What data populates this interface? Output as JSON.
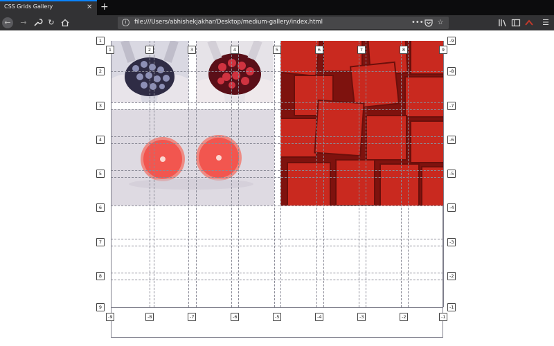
{
  "browser": {
    "tab_title": "CSS Grids Gallery",
    "tab_close_icon": "close-icon",
    "new_tab_icon": "plus-icon",
    "url": "file:///Users/abhishekjakhar/Desktop/medium-gallery/index.html",
    "accent_color": "#0a84ff"
  },
  "grid_overlay": {
    "column_labels_top": [
      "1",
      "2",
      "3",
      "4",
      "5",
      "6",
      "7",
      "8",
      "9"
    ],
    "column_labels_bottom": [
      "-9",
      "-8",
      "-7",
      "-6",
      "-5",
      "-4",
      "-3",
      "-2",
      "-1"
    ],
    "row_labels_left": [
      "1",
      "2",
      "3",
      "4",
      "5",
      "6",
      "7",
      "8",
      "9"
    ],
    "row_labels_right": [
      "-9",
      "-8",
      "-7",
      "-6",
      "-5",
      "-4",
      "-3",
      "-2",
      "-1"
    ],
    "line_color": "#8a8a96"
  },
  "gallery": {
    "images": [
      {
        "name": "grapes-photo",
        "colors": [
          "#2e2b42",
          "#8f92b8",
          "#dcdbe6"
        ]
      },
      {
        "name": "strawberries-photo",
        "colors": [
          "#7c1822",
          "#c92f3c",
          "#e6e4ea"
        ]
      },
      {
        "name": "grapefruit-photo",
        "colors": [
          "#f2645d",
          "#dcd8e0"
        ]
      },
      {
        "name": "watermelon-cubes-photo",
        "colors": [
          "#c5281f",
          "#7e120e"
        ]
      }
    ]
  }
}
